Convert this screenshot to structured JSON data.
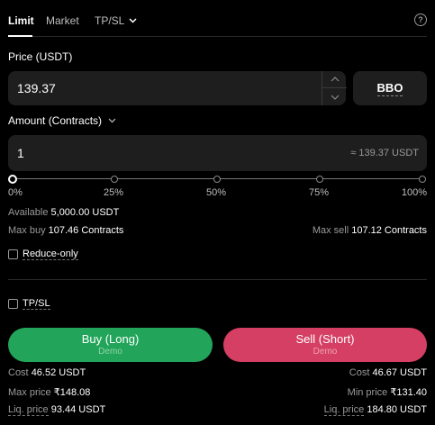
{
  "tabs": {
    "limit": "Limit",
    "market": "Market",
    "tpsl": "TP/SL"
  },
  "price": {
    "label": "Price (USDT)",
    "value": "139.37",
    "bbo": "BBO"
  },
  "amount": {
    "label": "Amount (Contracts)",
    "value": "1",
    "approx": "≈ 139.37 USDT"
  },
  "slider": {
    "value_percent": 0,
    "marks": [
      "0%",
      "25%",
      "50%",
      "75%",
      "100%"
    ]
  },
  "available": {
    "label": "Available",
    "value": "5,000.00 USDT"
  },
  "max_buy": {
    "label": "Max buy",
    "value": "107.46 Contracts"
  },
  "max_sell": {
    "label": "Max sell",
    "value": "107.12 Contracts"
  },
  "reduce_only": {
    "label": "Reduce-only",
    "checked": false
  },
  "tpsl_option": {
    "label": "TP/SL",
    "checked": false
  },
  "buy_button": {
    "label": "Buy (Long)",
    "sub": "Demo",
    "color": "#22a55a"
  },
  "sell_button": {
    "label": "Sell (Short)",
    "sub": "Demo",
    "color": "#d43f63"
  },
  "buy_info": {
    "cost_label": "Cost",
    "cost_value": "46.52 USDT",
    "max_price_label": "Max price",
    "max_price_value": "₹148.08",
    "liq_label": "Liq. price",
    "liq_value": "93.44 USDT"
  },
  "sell_info": {
    "cost_label": "Cost",
    "cost_value": "46.67 USDT",
    "min_price_label": "Min price",
    "min_price_value": "₹131.40",
    "liq_label": "Liq. price",
    "liq_value": "184.80 USDT"
  },
  "icons": {
    "tab_dropdown": "chevron-down-icon",
    "help": "question-circle-icon",
    "step_up": "chevron-up-icon",
    "step_down": "chevron-down-icon",
    "amount_dropdown": "chevron-down-icon"
  }
}
